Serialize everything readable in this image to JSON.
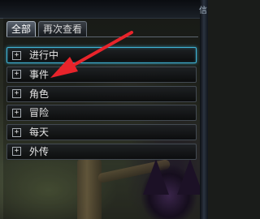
{
  "tabs": [
    {
      "label": "全部",
      "active": true
    },
    {
      "label": "再次查看",
      "active": false
    }
  ],
  "categories": [
    {
      "label": "进行中",
      "expand_symbol": "+",
      "selected": true
    },
    {
      "label": "事件",
      "expand_symbol": "+",
      "selected": false
    },
    {
      "label": "角色",
      "expand_symbol": "+",
      "selected": false
    },
    {
      "label": "冒险",
      "expand_symbol": "+",
      "selected": false
    },
    {
      "label": "每天",
      "expand_symbol": "+",
      "selected": false
    },
    {
      "label": "外传",
      "expand_symbol": "+",
      "selected": false
    }
  ],
  "window_edge_glyph": "信",
  "colors": {
    "selection_border": "#3fb4d6",
    "annotation_arrow": "#e8242b"
  }
}
